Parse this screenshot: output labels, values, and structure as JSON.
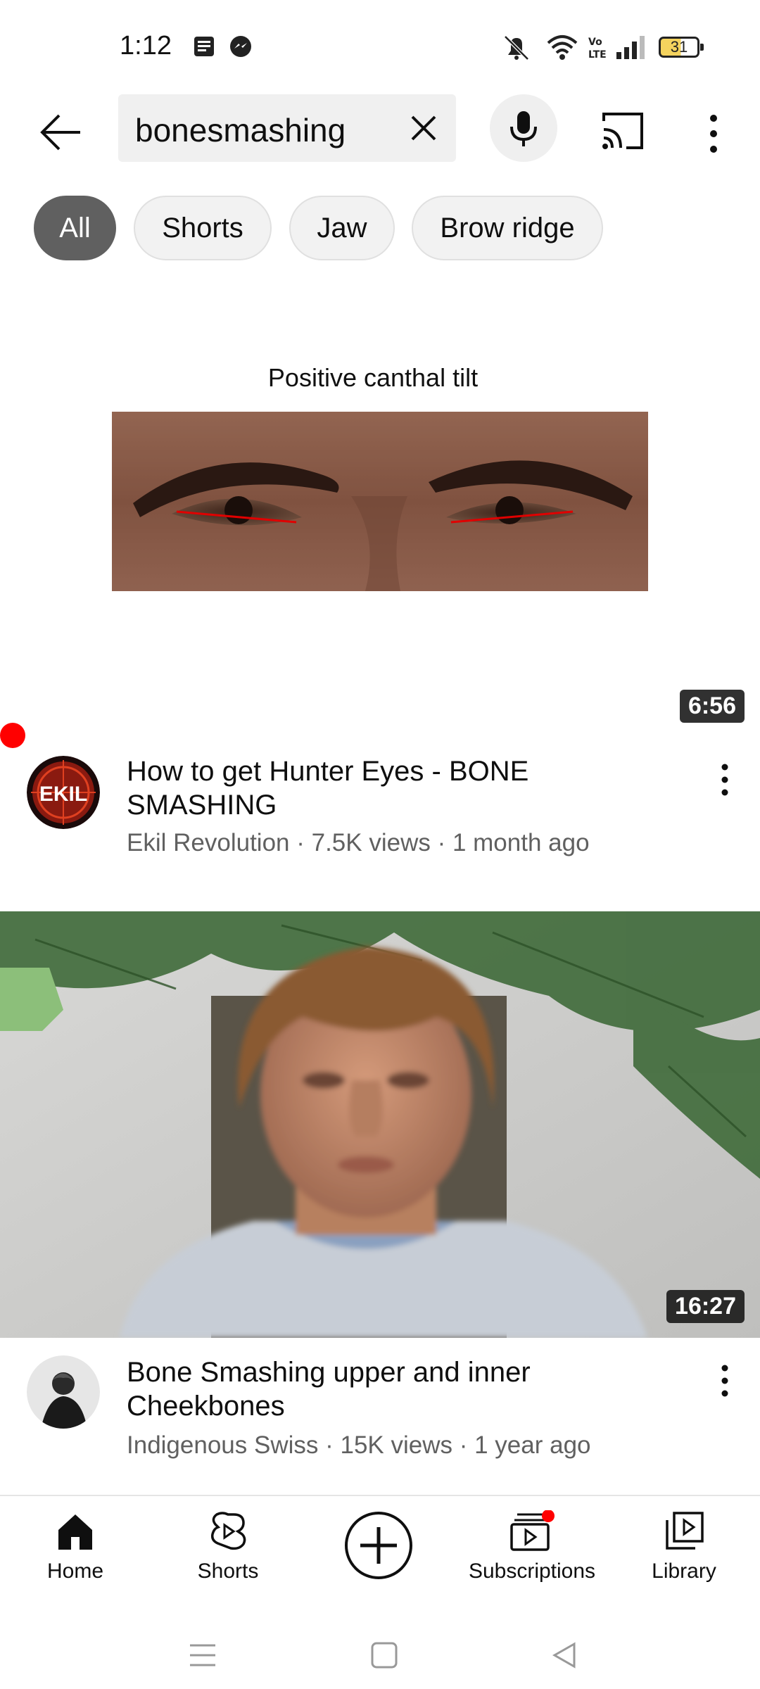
{
  "status_bar": {
    "time": "1:12",
    "battery": "31",
    "icons": [
      "news-icon",
      "messenger-icon",
      "mute-icon",
      "wifi-icon",
      "volte-icon",
      "signal-icon",
      "battery-icon"
    ]
  },
  "search": {
    "query": "bonesmashing",
    "icons": [
      "back-arrow-icon",
      "clear-icon",
      "mic-icon",
      "cast-icon",
      "more-vert-icon"
    ]
  },
  "chips": [
    {
      "label": "All",
      "active": true
    },
    {
      "label": "Shorts",
      "active": false
    },
    {
      "label": "Jaw",
      "active": false
    },
    {
      "label": "Brow ridge",
      "active": false
    }
  ],
  "videos": [
    {
      "thumbnail_caption": "Positive canthal tilt",
      "duration": "6:56",
      "title": "How to get Hunter Eyes - BONE SMASHING",
      "channel": "Ekil Revolution",
      "views": "7.5K views",
      "age": "1 month ago",
      "avatar_text": "EKIL",
      "subtitle": "Ekil Revolution · 7.5K views · 1 month ago"
    },
    {
      "duration": "16:27",
      "title": "Bone Smashing upper and inner Cheekbones",
      "channel": "Indigenous Swiss",
      "views": "15K views",
      "age": "1 year ago",
      "subtitle": "Indigenous Swiss · 15K views · 1 year ago"
    }
  ],
  "bottom_nav": {
    "home": "Home",
    "shorts": "Shorts",
    "subscriptions": "Subscriptions",
    "library": "Library",
    "subscriptions_badge_color": "#ff0000"
  },
  "colors": {
    "accent": "#ff0000",
    "chip_active": "#606060",
    "secondary_text": "#606060"
  }
}
